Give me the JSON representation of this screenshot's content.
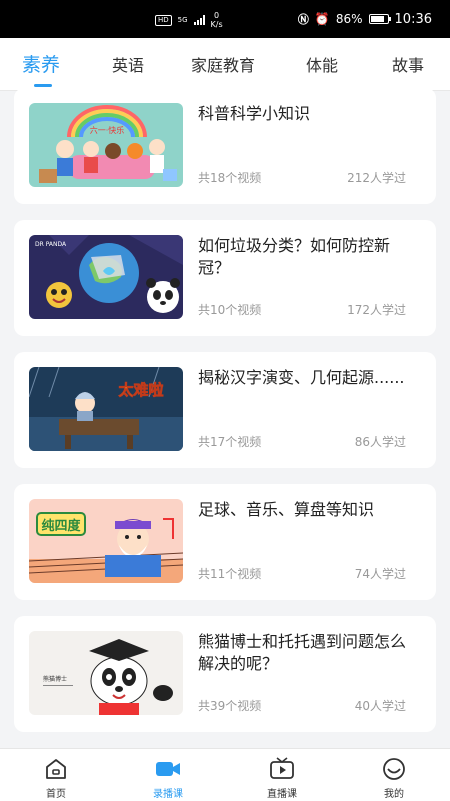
{
  "status_bar": {
    "hd": "HD",
    "network": "5G",
    "speed_value": "0",
    "speed_unit": "K/s",
    "battery": "86%",
    "time": "10:36"
  },
  "tabs": [
    {
      "label": "素养",
      "active": true
    },
    {
      "label": "英语",
      "active": false
    },
    {
      "label": "家庭教育",
      "active": false
    },
    {
      "label": "体能",
      "active": false
    },
    {
      "label": "故事",
      "active": false
    }
  ],
  "courses": [
    {
      "title": "科普科学小知识",
      "count": "共18个视频",
      "learners": "212人学过",
      "thumb_text": "六一·快乐"
    },
    {
      "title": "如何垃圾分类？如何防控新冠？",
      "count": "共10个视频",
      "learners": "172人学过",
      "thumb_text": "DR PANDA"
    },
    {
      "title": "揭秘汉字演变、几何起源......",
      "count": "共17个视频",
      "learners": "86人学过",
      "thumb_text": "太难啦"
    },
    {
      "title": "足球、音乐、算盘等知识",
      "count": "共11个视频",
      "learners": "74人学过",
      "thumb_text": "纯四度"
    },
    {
      "title": "熊猫博士和托托遇到问题怎么解决的呢？",
      "count": "共39个视频",
      "learners": "40人学过",
      "thumb_text": "熊猫博士"
    }
  ],
  "bottom_nav": [
    {
      "label": "首页",
      "icon": "home-icon",
      "active": false
    },
    {
      "label": "录播课",
      "icon": "video-camera-icon",
      "active": true
    },
    {
      "label": "直播课",
      "icon": "tv-icon",
      "active": false
    },
    {
      "label": "我的",
      "icon": "profile-icon",
      "active": false
    }
  ],
  "colors": {
    "accent": "#2a9bf0",
    "text": "#222222",
    "muted": "#999999",
    "background": "#f3f4f6"
  }
}
